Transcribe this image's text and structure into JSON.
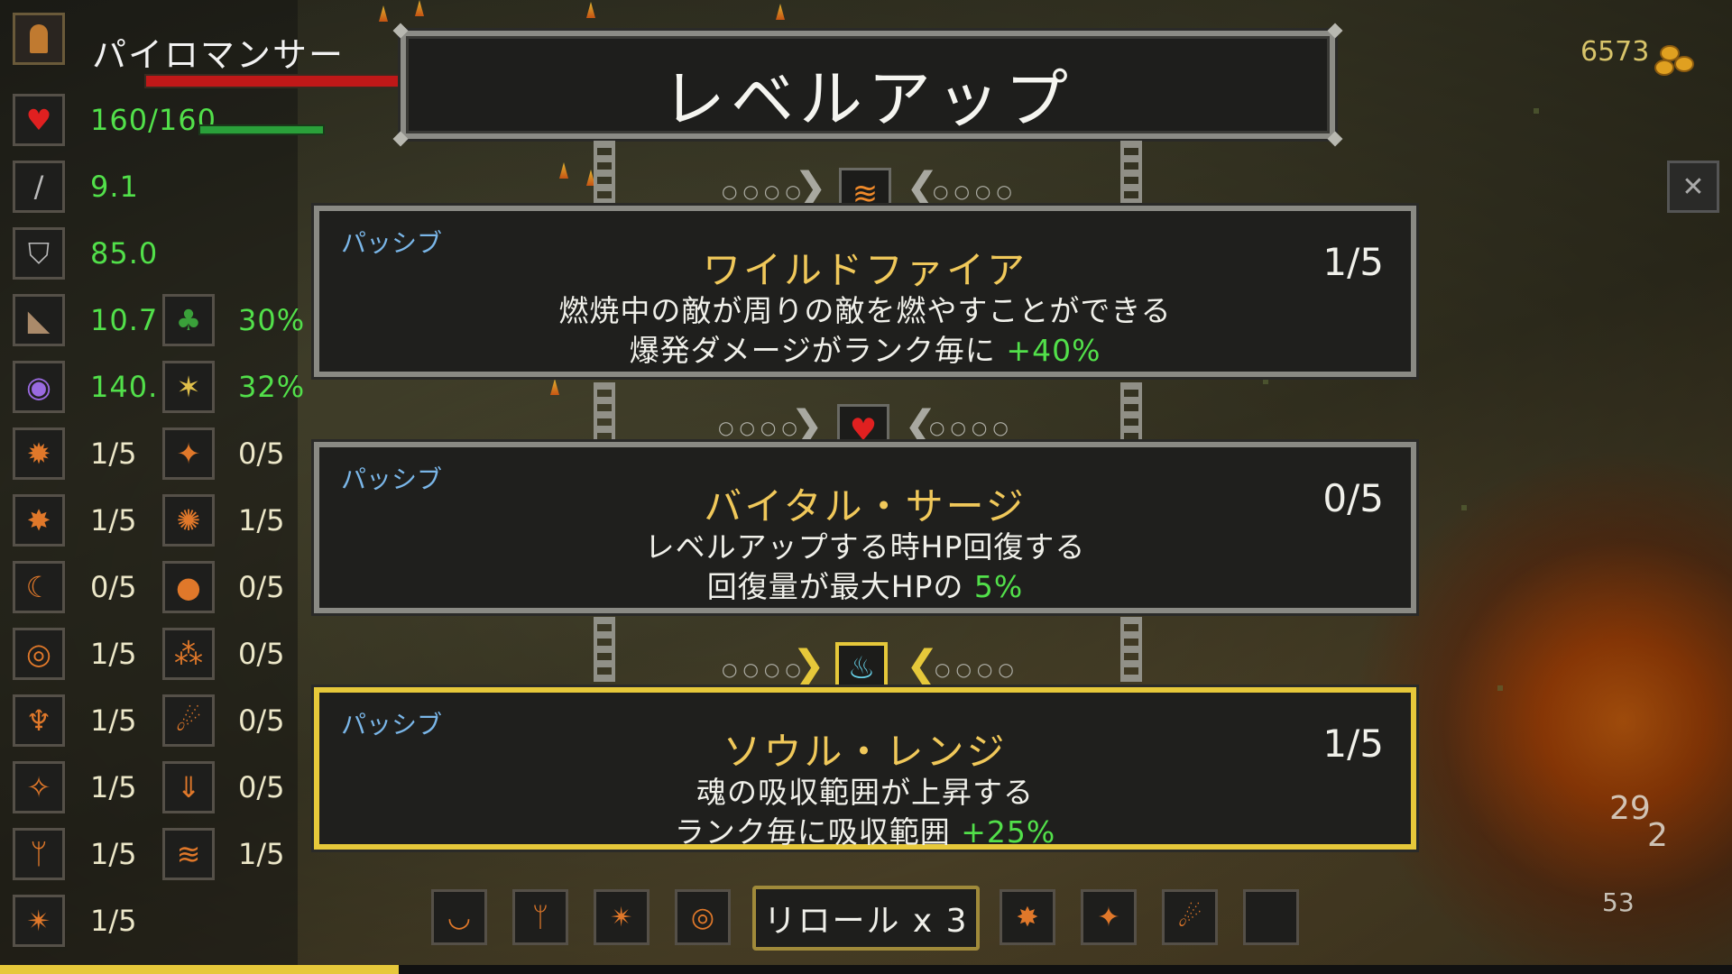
{
  "hud": {
    "character_name": "パイロマンサー",
    "hp": "160/160",
    "attack": "9.1",
    "defense": "85.0",
    "speed": "10.7",
    "luck": "30%",
    "magic": "140.",
    "crit": "32%",
    "skills_left": [
      "1/5",
      "1/5",
      "0/5",
      "1/5",
      "1/5",
      "1/5",
      "1/5",
      "1/5"
    ],
    "skills_right": [
      "0/5",
      "1/5",
      "0/5",
      "0/5",
      "0/5",
      "0/5",
      "1/5"
    ],
    "gold": "6573",
    "floating_numbers": [
      "29",
      "2",
      "53"
    ]
  },
  "levelup": {
    "title": "レベルアップ",
    "cards": [
      {
        "kind": "パッシブ",
        "name": "ワイルドファイア",
        "rank": "1/5",
        "desc1": "燃焼中の敵が周りの敵を燃やすことができる",
        "desc2_prefix": "爆発ダメージがランク毎に",
        "desc2_value": "+40%",
        "icon": "wildfire-icon",
        "selected": false
      },
      {
        "kind": "パッシブ",
        "name": "バイタル・サージ",
        "rank": "0/5",
        "desc1": "レベルアップする時HP回復する",
        "desc2_prefix": "回復量が最大HPの",
        "desc2_value": "5%",
        "icon": "heart-icon",
        "selected": false
      },
      {
        "kind": "パッシブ",
        "name": "ソウル・レンジ",
        "rank": "1/5",
        "desc1": "魂の吸収範囲が上昇する",
        "desc2_prefix": "ランク毎に吸収範囲",
        "desc2_value": "+25%",
        "icon": "soul-flame-icon",
        "selected": true
      }
    ],
    "reroll_label": "リロール x 3"
  },
  "colors": {
    "accent_gold": "#e6c83a",
    "stat_green": "#52e04a",
    "skill_name": "#f0c85a",
    "passive_blue": "#7ab6e8"
  },
  "xp_progress": 0.23
}
